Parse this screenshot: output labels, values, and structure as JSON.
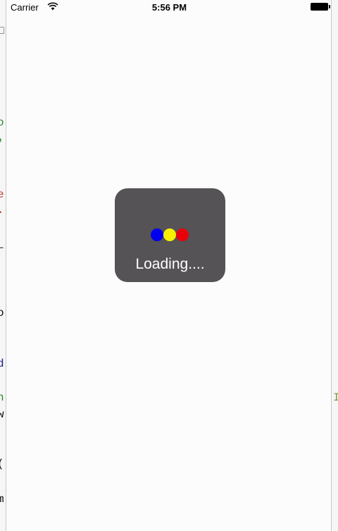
{
  "status_bar": {
    "carrier": "Carrier",
    "time": "5:56 PM",
    "wifi_icon": "wifi-icon",
    "battery_icon": "battery-icon"
  },
  "hud": {
    "label": "Loading....",
    "dot_colors": [
      "#0000ee",
      "#f6f000",
      "#e8000a"
    ],
    "background": "#555355"
  },
  "background_gutter": {
    "left_chars": [
      {
        "char": "□",
        "color": "#555555"
      },
      {
        "char": "o",
        "color": "#2a8a2a"
      },
      {
        "char": "'",
        "color": "#2a8a2a"
      },
      {
        "char": "e",
        "color": "#c0392b"
      },
      {
        "char": ".",
        "color": "#c0392b"
      },
      {
        "char": "L",
        "color": "#444444"
      },
      {
        "char": "o",
        "color": "#111111"
      },
      {
        "char": "d",
        "color": "#1a1a8c"
      },
      {
        "char": "n",
        "color": "#2a8a2a"
      },
      {
        "char": "w",
        "color": "#111111"
      },
      {
        "char": "(",
        "color": "#111111"
      },
      {
        "char": "m",
        "color": "#111111"
      }
    ],
    "right_chars": [
      {
        "char": "I",
        "color": "#7a9a3a"
      }
    ]
  }
}
